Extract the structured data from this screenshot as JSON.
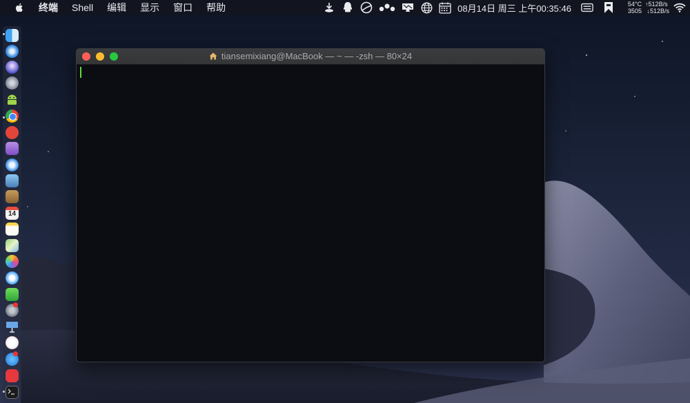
{
  "menubar": {
    "app_name": "终端",
    "items": [
      "Shell",
      "编辑",
      "显示",
      "窗口",
      "帮助"
    ],
    "clock": "08月14日 周三 上午00:35:46",
    "stats": {
      "temp": "54°C",
      "fan": "3505",
      "up": "↑512B/s",
      "down": "↓512B/s"
    },
    "icons": [
      "download-icon",
      "qq-icon",
      "pie-icon",
      "dots-icon",
      "display-icon",
      "globe-icon",
      "calendar-icon",
      "switch-icon",
      "bookmark-icon",
      "wifi-icon"
    ]
  },
  "terminal": {
    "title": "tiansemixiang@MacBook — ~ — -zsh — 80×24",
    "cursor_color": "#5fdc3e",
    "background": "#0c0d12"
  },
  "dock": {
    "icons": [
      "finder-icon",
      "safari-icon",
      "siri-icon",
      "launchpad-icon",
      "android-icon",
      "chrome-icon",
      "app-icon",
      "simulator-icon",
      "safari-compass-icon",
      "preview-icon",
      "notes-icon",
      "calendar-icon",
      "notepad-icon",
      "maps-icon",
      "photos-icon",
      "messages-icon",
      "facetime-icon",
      "system-preferences-icon",
      "keynote-icon",
      "music-icon",
      "appstore-icon",
      "vivaldi-icon",
      "terminal-icon"
    ],
    "calendar_day": "14"
  }
}
